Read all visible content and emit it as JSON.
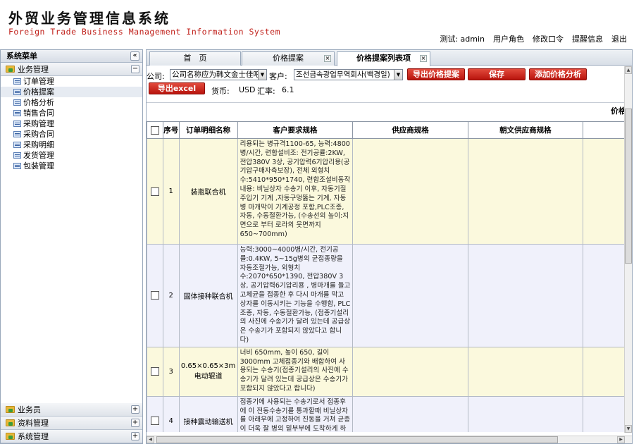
{
  "header": {
    "title": "外贸业务管理信息系统",
    "subtitle": "Foreign Trade Business Management Information System",
    "user_label": "测试: admin",
    "links": [
      "用户角色",
      "修改口令",
      "提醒信息",
      "退出"
    ]
  },
  "sidebar": {
    "title": "系统菜单",
    "collapse_icon": "«",
    "groups_top": [
      {
        "label": "业务管理",
        "toggle": "−"
      }
    ],
    "items": [
      "订单管理",
      "价格提案",
      "价格分析",
      "销售合同",
      "采购管理",
      "采购合同",
      "采购明细",
      "发货管理",
      "包装管理"
    ],
    "selected_item": "价格提案",
    "groups_bottom": [
      {
        "label": "业务员",
        "toggle": "+"
      },
      {
        "label": "资料管理",
        "toggle": "+"
      },
      {
        "label": "系统管理",
        "toggle": "+"
      }
    ]
  },
  "tabs": [
    {
      "label": "首　页",
      "closable": false
    },
    {
      "label": "价格提案",
      "closable": true
    },
    {
      "label": "价格提案列表项",
      "closable": true,
      "active": true
    }
  ],
  "toolbar": {
    "company_label": "公司:",
    "company_value": "公司名称应为韩文金士佳吧",
    "customer_label": "客户:",
    "customer_value": "조선금속광업무역회사(백경일)",
    "buttons": [
      "导出价格提案",
      "保存",
      "添加价格分析",
      "导出excel"
    ],
    "currency_label": "货币:",
    "currency_value": "USD",
    "rate_label": "汇率:",
    "rate_value": "6.1"
  },
  "grid": {
    "group_header": "价格",
    "columns": [
      "",
      "序号",
      "订单明细名称",
      "客户要求规格",
      "供应商规格",
      "朝文供应商规格",
      ""
    ],
    "rows": [
      {
        "no": "1",
        "name": "装瓶联合机",
        "spec": "리용되는 병규격1100-65, 능력:4800병/시간, 련합설비조: 전기공률:2KW, 전압380V 3상, 공기압력6기압리용(공기압구매자측보장), 전체 외형치수:5410*950*1740, 련합조설비동작내용: 비닐상자 수송기 이후, 자동기질주입기 기계 ,자동구멍뚫는 기계, 자동병 마개막이 기계공정 포함,PLC조종, 자동, 수동절환가능, (수송선의 높이:지면으로 부터 로라의 웃면까지 650~700mm)"
      },
      {
        "no": "2",
        "name": "固体接种联合机",
        "spec": "능력:3000~4000병/시간, 전기공률:0.4KW, 5~15g병의 균접종량을 자동조절가능, 외형치수:2070*650*1390, 전압380V 3상, 공기압력6기압리용 , 병마개를 들고 고체균을 접종한 후 다시 마개를 막고 상자를 이동시키는 기능을 수행함, PLC조종, 자동, 수동절환가능, (접종기설리의 사진에 수송기가 달려 있는데 공급상은 수송기가 포함되지 않았다고 합니다)"
      },
      {
        "no": "3",
        "name": "0.65×0.65×3m电动辊道",
        "spec": "너비 650mm, 높이 650, 길이 3000mm 고체접종기와 배합하여 사용되는 수송기(접종기설리의 사진에 수송기가 달려 있는데 공급상은 수송기가 포함되지 않았다고 합니다)"
      },
      {
        "no": "4",
        "name": "接种震动输送机",
        "spec": "접종기에 사용되는 수송기로서 접종후에 이 전동수송기를 통과할때 비닐상자를 아래우에 고정하여 진동을 거쳐 균종이 더욱 잘 병의 밑부부에 도착하게 하는 작용을 한다"
      }
    ]
  },
  "colors": {
    "accent_red": "#c0201a",
    "odd_row": "#fbf9dd",
    "even_row": "#f0f1fb"
  }
}
